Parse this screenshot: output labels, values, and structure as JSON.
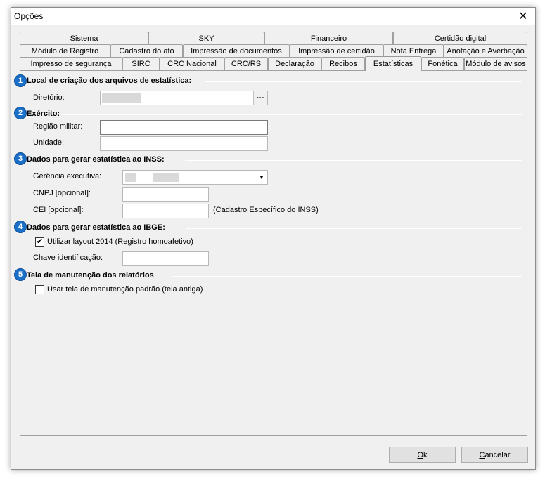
{
  "window": {
    "title": "Opções",
    "close_glyph": "✕"
  },
  "tabs": {
    "row1": [
      "Sistema",
      "SKY",
      "Financeiro",
      "Certidão digital"
    ],
    "row2": [
      "Módulo de Registro",
      "Cadastro do ato",
      "Impressão de documentos",
      "Impressão de certidão",
      "Nota Entrega",
      "Anotação e Averbação"
    ],
    "row3": [
      "Impresso de segurança",
      "SIRC",
      "CRC Nacional",
      "CRC/RS",
      "Declaração",
      "Recibos",
      "Estatísticas",
      "Fonética",
      "Módulo de avisos"
    ],
    "active": "Estatísticas"
  },
  "sections": {
    "s1": {
      "badge": "1",
      "title": "Local de criação dos arquivos de estatística:",
      "diretorio_label": "Diretório:",
      "browse_label": "···"
    },
    "s2": {
      "badge": "2",
      "title": "Exército:",
      "regiao_label": "Região militar:",
      "unidade_label": "Unidade:"
    },
    "s3": {
      "badge": "3",
      "title": "Dados para gerar estatística ao INSS:",
      "gerencia_label": "Gerência executiva:",
      "cnpj_label": "CNPJ [opcional]:",
      "cei_label": "CEI [opcional]:",
      "cei_hint": "(Cadastro Específico do INSS)"
    },
    "s4": {
      "badge": "4",
      "title": "Dados para gerar estatística ao IBGE:",
      "layout_label": "Utilizar layout 2014 (Registro homoafetivo)",
      "layout_checked": true,
      "chave_label": "Chave identificação:"
    },
    "s5": {
      "badge": "5",
      "title": "Tela de manutenção dos relatórios",
      "manut_label": "Usar tela de manutenção padrão (tela antiga)",
      "manut_checked": false
    }
  },
  "buttons": {
    "ok_prefix": "",
    "ok_u": "O",
    "ok_rest": "k",
    "cancel_prefix": "",
    "cancel_u": "C",
    "cancel_rest": "ancelar"
  },
  "colors": {
    "badge": "#1a6fc9",
    "window_bg": "#f0f0f0"
  }
}
